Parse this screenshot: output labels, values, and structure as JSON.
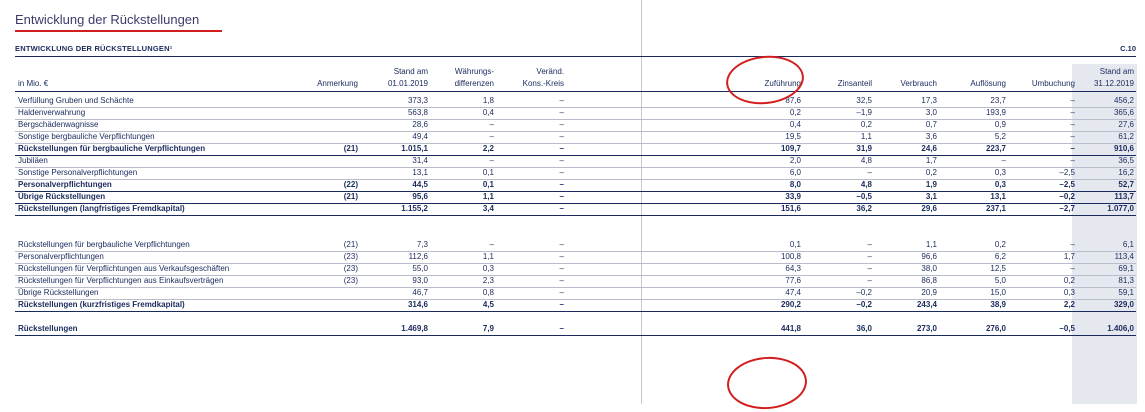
{
  "page_title": "Entwicklung der Rückstellungen",
  "table": {
    "title": "ENTWICKLUNG DER RÜCKSTELLUNGEN¹",
    "code": "C.10",
    "headers": {
      "unit": "in Mio. €",
      "note": "Anmerkung",
      "v0_top": "Stand am",
      "v0_bot": "01.01.2019",
      "v1_top": "Währungs-",
      "v1_bot": "differenzen",
      "v2_top": "Veränd.",
      "v2_bot": "Kons.-Kreis",
      "v3": "Zuführung",
      "v4": "Zinsanteil",
      "v5": "Verbrauch",
      "v6": "Auflösung",
      "v7": "Umbuchung",
      "v8_top": "Stand am",
      "v8_bot": "31.12.2019"
    },
    "rows": [
      {
        "label": "Verfüllung Gruben und Schächte",
        "note": "",
        "v": [
          "373,3",
          "1,8",
          "–",
          "87,6",
          "32,5",
          "17,3",
          "23,7",
          "–",
          "456,2"
        ],
        "bold": false
      },
      {
        "label": "Haldenverwahrung",
        "note": "",
        "v": [
          "563,8",
          "0,4",
          "–",
          "0,2",
          "–1,9",
          "3,0",
          "193,9",
          "–",
          "365,6"
        ],
        "bold": false
      },
      {
        "label": "Bergschädenwagnisse",
        "note": "",
        "v": [
          "28,6",
          "–",
          "–",
          "0,4",
          "0,2",
          "0,7",
          "0,9",
          "–",
          "27,6"
        ],
        "bold": false
      },
      {
        "label": "Sonstige bergbauliche Verpflichtungen",
        "note": "",
        "v": [
          "49,4",
          "–",
          "–",
          "19,5",
          "1,1",
          "3,6",
          "5,2",
          "–",
          "61,2"
        ],
        "bold": false
      },
      {
        "label": "Rückstellungen für bergbauliche Verpflichtungen",
        "note": "(21)",
        "v": [
          "1.015,1",
          "2,2",
          "–",
          "109,7",
          "31,9",
          "24,6",
          "223,7",
          "–",
          "910,6"
        ],
        "bold": true
      },
      {
        "label": "Jubiläen",
        "note": "",
        "v": [
          "31,4",
          "–",
          "–",
          "2,0",
          "4,8",
          "1,7",
          "–",
          "–",
          "36,5"
        ],
        "bold": false
      },
      {
        "label": "Sonstige Personalverpflichtungen",
        "note": "",
        "v": [
          "13,1",
          "0,1",
          "–",
          "6,0",
          "–",
          "0,2",
          "0,3",
          "–2,5",
          "16,2"
        ],
        "bold": false
      },
      {
        "label": "Personalverpflichtungen",
        "note": "(22)",
        "v": [
          "44,5",
          "0,1",
          "–",
          "8,0",
          "4,8",
          "1,9",
          "0,3",
          "–2,5",
          "52,7"
        ],
        "bold": true
      },
      {
        "label": "Übrige Rückstellungen",
        "note": "(21)",
        "v": [
          "95,6",
          "1,1",
          "–",
          "33,9",
          "–0,5",
          "3,1",
          "13,1",
          "–0,2",
          "113,7"
        ],
        "bold": true
      },
      {
        "label": "Rückstellungen (langfristiges Fremdkapital)",
        "note": "",
        "v": [
          "1.155,2",
          "3,4",
          "–",
          "151,6",
          "36,2",
          "29,6",
          "237,1",
          "–2,7",
          "1.077,0"
        ],
        "bold": true
      },
      {
        "label": "Rückstellungen für bergbauliche Verpflichtungen",
        "note": "(21)",
        "v": [
          "7,3",
          "–",
          "–",
          "0,1",
          "–",
          "1,1",
          "0,2",
          "–",
          "6,1"
        ],
        "bold": false
      },
      {
        "label": "Personalverpflichtungen",
        "note": "(23)",
        "v": [
          "112,6",
          "1,1",
          "–",
          "100,8",
          "–",
          "96,6",
          "6,2",
          "1,7",
          "113,4"
        ],
        "bold": false
      },
      {
        "label": "Rückstellungen für Verpflichtungen aus Verkaufsgeschäften",
        "note": "(23)",
        "v": [
          "55,0",
          "0,3",
          "–",
          "64,3",
          "–",
          "38,0",
          "12,5",
          "–",
          "69,1"
        ],
        "bold": false
      },
      {
        "label": "Rückstellungen für Verpflichtungen aus Einkaufsverträgen",
        "note": "(23)",
        "v": [
          "93,0",
          "2,3",
          "–",
          "77,6",
          "–",
          "86,8",
          "5,0",
          "0,2",
          "81,3"
        ],
        "bold": false
      },
      {
        "label": "Übrige Rückstellungen",
        "note": "",
        "v": [
          "46,7",
          "0,8",
          "–",
          "47,4",
          "–0,2",
          "20,9",
          "15,0",
          "0,3",
          "59,1"
        ],
        "bold": false
      },
      {
        "label": "Rückstellungen (kurzfristiges Fremdkapital)",
        "note": "",
        "v": [
          "314,6",
          "4,5",
          "–",
          "290,2",
          "–0,2",
          "243,4",
          "38,9",
          "2,2",
          "329,0"
        ],
        "bold": true
      },
      {
        "label": "Rückstellungen",
        "note": "",
        "v": [
          "1.469,8",
          "7,9",
          "–",
          "441,8",
          "36,0",
          "273,0",
          "276,0",
          "–0,5",
          "1.406,0"
        ],
        "bold": true
      }
    ]
  },
  "annotation_color": "#d21e1e"
}
